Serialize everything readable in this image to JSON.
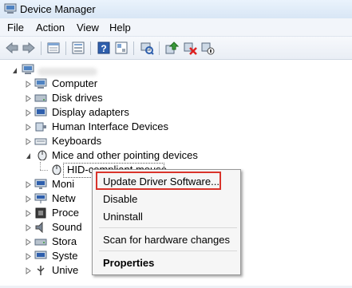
{
  "window": {
    "title": "Device Manager"
  },
  "menu": [
    "File",
    "Action",
    "View",
    "Help"
  ],
  "toolbar_icons": [
    "back-arrow-icon",
    "forward-arrow-icon",
    "properties-icon",
    "show-hide-tree-icon",
    "help-icon",
    "driver-update-icon",
    "scan-hardware-icon",
    "update-driver-icon",
    "uninstall-icon",
    "disable-icon"
  ],
  "tree": {
    "items": [
      {
        "label": "Computer",
        "icon": "computer-icon"
      },
      {
        "label": "Disk drives",
        "icon": "disk-drive-icon"
      },
      {
        "label": "Display adapters",
        "icon": "display-adapter-icon"
      },
      {
        "label": "Human Interface Devices",
        "icon": "hid-icon"
      },
      {
        "label": "Keyboards",
        "icon": "keyboard-icon"
      },
      {
        "label": "Mice and other pointing devices",
        "icon": "mouse-icon"
      },
      {
        "label": "HID-compliant mouse",
        "icon": "mouse-icon"
      },
      {
        "label": "Moni",
        "icon": "monitor-icon"
      },
      {
        "label": "Netw",
        "icon": "network-icon"
      },
      {
        "label": "Proce",
        "icon": "processor-icon"
      },
      {
        "label": "Sound",
        "icon": "sound-icon"
      },
      {
        "label": "Stora",
        "icon": "storage-icon"
      },
      {
        "label": "Syste",
        "icon": "system-icon"
      },
      {
        "label": "Unive",
        "icon": "usb-icon"
      }
    ]
  },
  "context_menu": {
    "items": [
      "Update Driver Software...",
      "Disable",
      "Uninstall",
      "Scan for hardware changes",
      "Properties"
    ]
  },
  "colors": {
    "highlight": "#d9342b",
    "title_bar": "#dce9f6"
  }
}
